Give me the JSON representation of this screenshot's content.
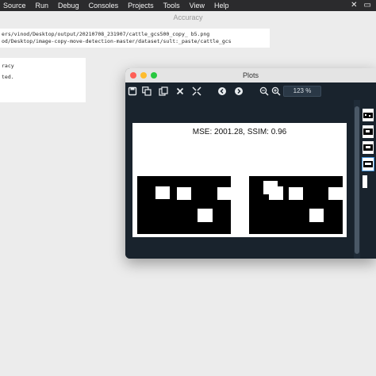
{
  "menubar": {
    "items": [
      "Source",
      "Run",
      "Debug",
      "Consoles",
      "Projects",
      "Tools",
      "View",
      "Help"
    ],
    "right_icons": [
      "close-x-icon",
      "folder-icon"
    ]
  },
  "main_window": {
    "title": "Accuracy",
    "path_lines": [
      "ers/vinod/Desktop/output/20210708_231907/cattle_gcs500_copy_ b5.png",
      "od/Desktop/image-copy-move-detection-master/dataset/sult:_paste/cattle_gcs"
    ],
    "console_lines": [
      "racy",
      "ted."
    ]
  },
  "plots_window": {
    "title": "Plots",
    "toolbar": {
      "zoom_value": "123 %",
      "icons": [
        "save-icon",
        "save-all-icon",
        "copy-icon",
        "close-icon",
        "close-all-icon",
        "previous-icon",
        "next-icon",
        "zoom-out-icon",
        "zoom-in-icon"
      ]
    },
    "figure": {
      "title": "MSE: 2001.28, SSIM: 0.96",
      "panels": [
        {
          "name": "left-image",
          "background": "#000000",
          "squares_color": "#ffffff"
        },
        {
          "name": "right-image",
          "background": "#000000",
          "squares_color": "#ffffff"
        }
      ]
    },
    "thumbnail_count": 4,
    "selected_thumbnail": 3
  },
  "colors": {
    "menubar_bg": "#2b2b2d",
    "plots_bg": "#19232d",
    "accent": "#3d8fd6"
  }
}
